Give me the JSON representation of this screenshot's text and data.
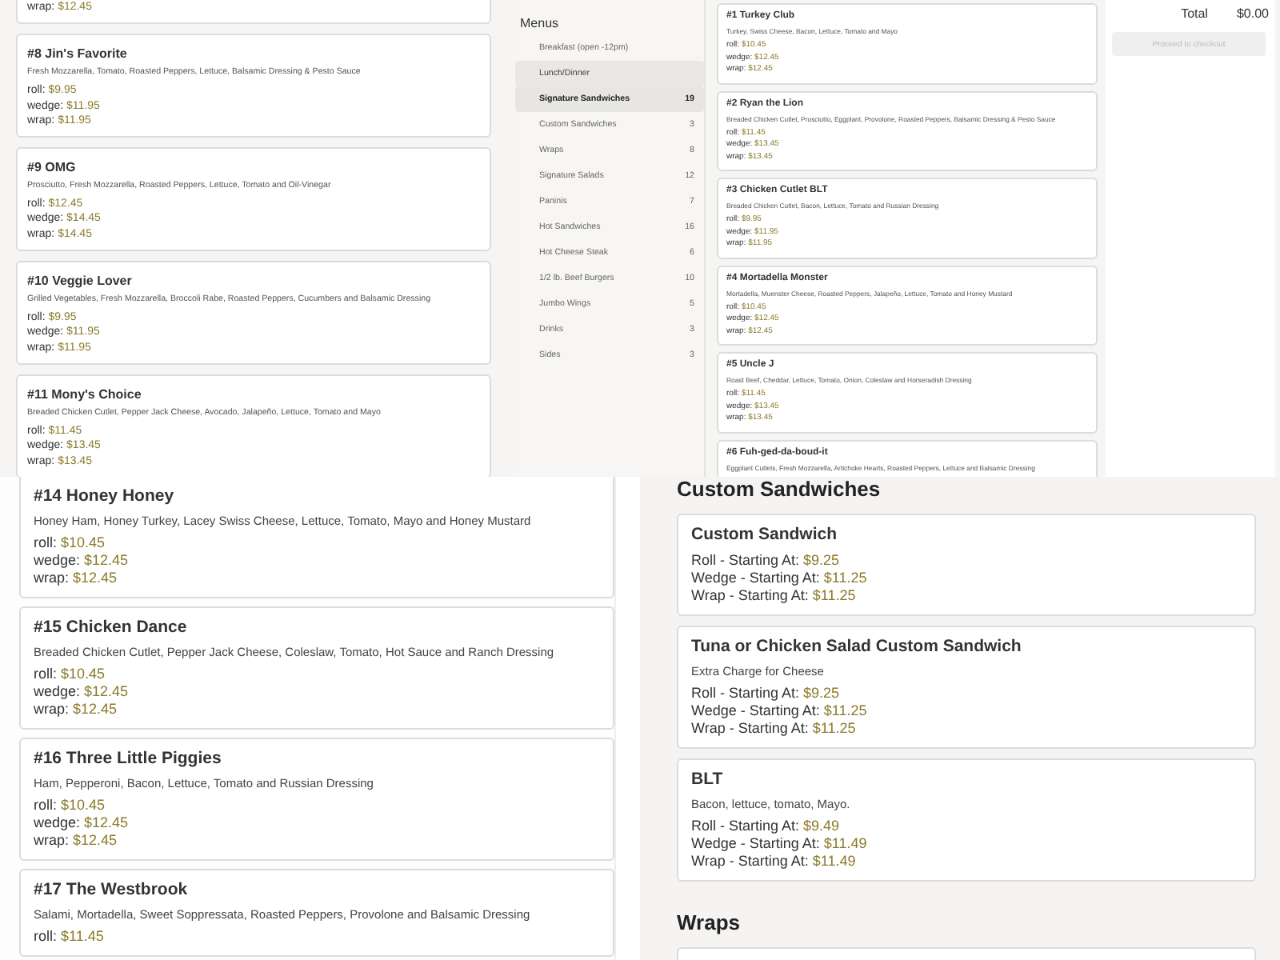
{
  "top_left_cards": [
    {
      "prices": [
        {
          "label": "wrap:",
          "price": "$12.45"
        }
      ]
    },
    {
      "title": "#8 Jin's Favorite",
      "description": "Fresh Mozzarella, Tomato, Roasted Peppers, Lettuce, Balsamic Dressing & Pesto Sauce",
      "prices": [
        {
          "label": "roll:",
          "price": "$9.95"
        },
        {
          "label": "wedge:",
          "price": "$11.95"
        },
        {
          "label": "wrap:",
          "price": "$11.95"
        }
      ]
    },
    {
      "title": "#9 OMG",
      "description": "Prosciutto, Fresh Mozzarella, Roasted Peppers, Lettuce, Tomato and Oil-Vinegar",
      "prices": [
        {
          "label": "roll:",
          "price": "$12.45"
        },
        {
          "label": "wedge:",
          "price": "$14.45"
        },
        {
          "label": "wrap:",
          "price": "$14.45"
        }
      ]
    },
    {
      "title": "#10 Veggie Lover",
      "description": "Grilled Vegetables, Fresh Mozzarella, Broccoli Rabe, Roasted Peppers, Cucumbers and Balsamic Dressing",
      "prices": [
        {
          "label": "roll:",
          "price": "$9.95"
        },
        {
          "label": "wedge:",
          "price": "$11.95"
        },
        {
          "label": "wrap:",
          "price": "$11.95"
        }
      ]
    },
    {
      "title": "#11 Mony's Choice",
      "description": "Breaded Chicken Cutlet, Pepper Jack Cheese, Avocado, Jalapeño, Lettuce, Tomato and Mayo",
      "prices": [
        {
          "label": "roll:",
          "price": "$11.45"
        },
        {
          "label": "wedge:",
          "price": "$13.45"
        },
        {
          "label": "wrap:",
          "price": "$13.45"
        }
      ]
    }
  ],
  "menus": {
    "heading": "Menus",
    "items": [
      {
        "label": "Breakfast (open -12pm)",
        "selected": false,
        "expanded": false
      },
      {
        "label": "Lunch/Dinner",
        "selected": false,
        "expanded": true
      },
      {
        "label": "Signature Sandwiches",
        "count": "19",
        "selected": true
      },
      {
        "label": "Custom Sandwiches",
        "count": "3",
        "selected": false
      },
      {
        "label": "Wraps",
        "count": "8",
        "selected": false
      },
      {
        "label": "Signature Salads",
        "count": "12",
        "selected": false
      },
      {
        "label": "Paninis",
        "count": "7",
        "selected": false
      },
      {
        "label": "Hot Sandwiches",
        "count": "16",
        "selected": false
      },
      {
        "label": "Hot Cheese Steak",
        "count": "6",
        "selected": false
      },
      {
        "label": "1/2 lb. Beef Burgers",
        "count": "10",
        "selected": false
      },
      {
        "label": "Jumbo Wings",
        "count": "5",
        "selected": false
      },
      {
        "label": "Drinks",
        "count": "3",
        "selected": false
      },
      {
        "label": "Sides",
        "count": "3",
        "selected": false
      }
    ]
  },
  "top_right_cards": [
    {
      "title": "#1 Turkey Club",
      "description": "Turkey, Swiss Cheese, Bacon, Lettuce, Tomato and Mayo",
      "prices": [
        {
          "label": "roll:",
          "price": "$10.45"
        },
        {
          "label": "wedge:",
          "price": "$12.45"
        },
        {
          "label": "wrap:",
          "price": "$12.45"
        }
      ]
    },
    {
      "title": "#2 Ryan the Lion",
      "description": "Breaded Chicken Cutlet, Prosciutto, Eggplant, Provolone, Roasted Peppers, Balsamic Dressing & Pesto Sauce",
      "prices": [
        {
          "label": "roll:",
          "price": "$11.45"
        },
        {
          "label": "wedge:",
          "price": "$13.45"
        },
        {
          "label": "wrap:",
          "price": "$13.45"
        }
      ]
    },
    {
      "title": "#3 Chicken Cutlet BLT",
      "description": "Breaded Chicken Cutlet, Bacon, Lettuce, Tomato and Russian Dressing",
      "prices": [
        {
          "label": "roll:",
          "price": "$9.95"
        },
        {
          "label": "wedge:",
          "price": "$11.95"
        },
        {
          "label": "wrap:",
          "price": "$11.95"
        }
      ]
    },
    {
      "title": "#4 Mortadella Monster",
      "description": "Mortadella, Muenster Cheese, Roasted Peppers, Jalapeño, Lettuce, Tomato and Honey Mustard",
      "prices": [
        {
          "label": "roll:",
          "price": "$10.45"
        },
        {
          "label": "wedge:",
          "price": "$12.45"
        },
        {
          "label": "wrap:",
          "price": "$12.45"
        }
      ]
    },
    {
      "title": "#5 Uncle J",
      "description": "Roast Beef, Cheddar, Lettuce, Tomato, Onion, Coleslaw and Horseradish Dressing",
      "prices": [
        {
          "label": "roll:",
          "price": "$11.45"
        },
        {
          "label": "wedge:",
          "price": "$13.45"
        },
        {
          "label": "wrap:",
          "price": "$13.45"
        }
      ]
    },
    {
      "title": "#6 Fuh-ged-da-boud-it",
      "description": "Eggplant Cutlets, Fresh Mozzarella, Artichoke Hearts, Roasted Peppers, Lettuce and Balsamic Dressing"
    }
  ],
  "checkout": {
    "total_label": "Total",
    "total": "$0.00",
    "button": {
      "label": "Proceed to checkout",
      "disabled": true
    }
  },
  "bottom_left_cards": [
    {
      "title": "#14 Honey Honey",
      "description": "Honey Ham, Honey Turkey, Lacey Swiss Cheese, Lettuce, Tomato, Mayo and Honey Mustard",
      "prices": [
        {
          "label": "roll:",
          "price": "$10.45"
        },
        {
          "label": "wedge:",
          "price": "$12.45"
        },
        {
          "label": "wrap:",
          "price": "$12.45"
        }
      ]
    },
    {
      "title": "#15 Chicken Dance",
      "description": "Breaded Chicken Cutlet, Pepper Jack Cheese, Coleslaw, Tomato, Hot Sauce and Ranch Dressing",
      "prices": [
        {
          "label": "roll:",
          "price": "$10.45"
        },
        {
          "label": "wedge:",
          "price": "$12.45"
        },
        {
          "label": "wrap:",
          "price": "$12.45"
        }
      ]
    },
    {
      "title": "#16 Three Little Piggies",
      "description": "Ham, Pepperoni, Bacon, Lettuce, Tomato and Russian Dressing",
      "prices": [
        {
          "label": "roll:",
          "price": "$10.45"
        },
        {
          "label": "wedge:",
          "price": "$12.45"
        },
        {
          "label": "wrap:",
          "price": "$12.45"
        }
      ]
    },
    {
      "title": "#17 The Westbrook",
      "description": "Salami, Mortadella, Sweet Soppressata, Roasted Peppers, Provolone and Balsamic Dressing",
      "prices": [
        {
          "label": "roll:",
          "price": "$11.45"
        }
      ]
    }
  ],
  "bottom_right": {
    "heading": "Custom Sandwiches",
    "cards": [
      {
        "title": "Custom Sandwich",
        "prices": [
          {
            "label": "Roll - Starting At:",
            "price": "$9.25"
          },
          {
            "label": "Wedge - Starting At:",
            "price": "$11.25"
          },
          {
            "label": "Wrap - Starting At:",
            "price": "$11.25"
          }
        ]
      },
      {
        "title": "Tuna or Chicken Salad Custom Sandwich",
        "description": "Extra Charge for Cheese",
        "prices": [
          {
            "label": "Roll - Starting At:",
            "price": "$9.25"
          },
          {
            "label": "Wedge - Starting At:",
            "price": "$11.25"
          },
          {
            "label": "Wrap - Starting At:",
            "price": "$11.25"
          }
        ]
      },
      {
        "title": "BLT",
        "description": "Bacon, lettuce, tomato, Mayo.",
        "prices": [
          {
            "label": "Roll - Starting At:",
            "price": "$9.49"
          },
          {
            "label": "Wedge - Starting At:",
            "price": "$11.49"
          },
          {
            "label": "Wrap - Starting At:",
            "price": "$11.49"
          }
        ]
      }
    ],
    "next_heading": "Wraps"
  }
}
